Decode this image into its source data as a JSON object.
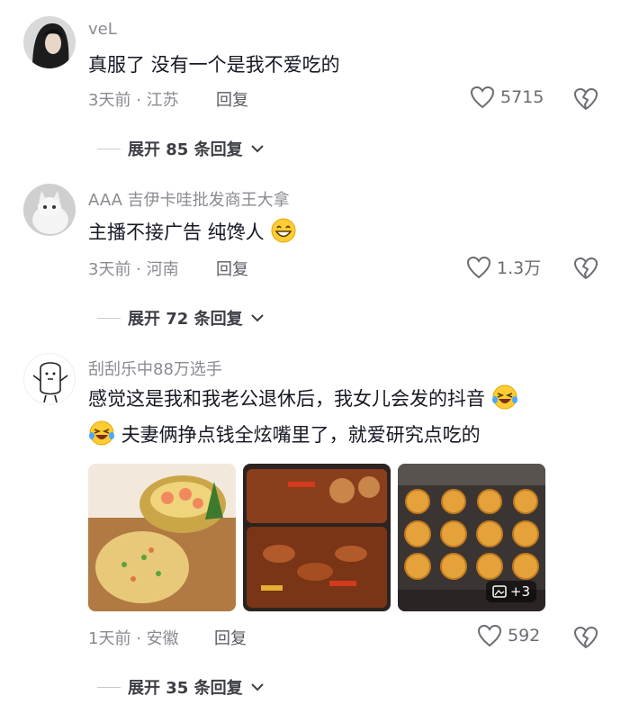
{
  "comments": [
    {
      "username": "veL",
      "text_lines": [
        "真服了 没有一个是我不爱吃的"
      ],
      "time": "3天前",
      "location": "江苏",
      "reply_label": "回复",
      "likes": "5715",
      "expand_label": "展开 85 条回复"
    },
    {
      "username": "AAA 吉伊卡哇批发商王大拿",
      "text_lines": [
        "主播不接广告 纯馋人"
      ],
      "time": "3天前",
      "location": "河南",
      "reply_label": "回复",
      "likes": "1.3万",
      "expand_label": "展开 72 条回复"
    },
    {
      "username": "刮刮乐中88万选手",
      "text_lines": [
        "感觉这是我和我老公退休后，我女儿会发的抖音",
        "夫妻俩挣点钱全炫嘴里了，就爱研究点吃的"
      ],
      "time": "1天前",
      "location": "安徽",
      "reply_label": "回复",
      "likes": "592",
      "expand_label": "展开 35 条回复",
      "more_images": "+3"
    }
  ],
  "separator": "·",
  "icons": {
    "like": "heart-outline-icon",
    "dislike": "broken-heart-icon",
    "chevron": "chevron-down-icon"
  }
}
